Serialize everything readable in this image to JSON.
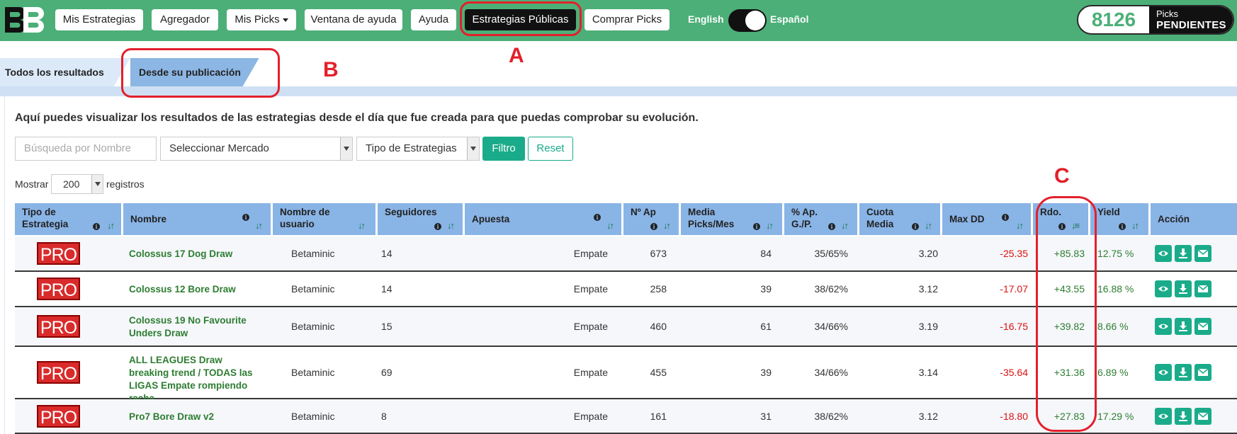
{
  "nav": {
    "logo": "BB",
    "items": [
      {
        "label": "Mis Estrategias"
      },
      {
        "label": "Agregador"
      },
      {
        "label": "Mis Picks"
      },
      {
        "label": "Ventana de ayuda"
      },
      {
        "label": "Ayuda"
      },
      {
        "label": "Estrategias Públicas"
      },
      {
        "label": "Comprar Picks"
      }
    ],
    "lang_left": "English",
    "lang_right": "Español",
    "picks_count": "8126",
    "picks_label_1": "Picks",
    "picks_label_2": "PENDIENTES"
  },
  "annotations": {
    "a": "A",
    "b": "B",
    "c": "C"
  },
  "tabs": [
    {
      "label": "Todos los resultados"
    },
    {
      "label": "Desde su publicación"
    }
  ],
  "intro": "Aquí puedes visualizar los resultados de las estrategias desde el día que fue creada para que puedas comprobar su evolución.",
  "filters": {
    "search_placeholder": "Búsqueda por Nombre",
    "market": "Seleccionar Mercado",
    "type": "Tipo de Estrategias",
    "filter_btn": "Filtro",
    "reset_btn": "Reset"
  },
  "show": {
    "prefix": "Mostrar",
    "value": "200",
    "suffix": "registros"
  },
  "columns": [
    {
      "l1": "Tipo de",
      "l2": "Estrategia"
    },
    {
      "l1": "Nombre",
      "l2": ""
    },
    {
      "l1": "Nombre de",
      "l2": "usuario"
    },
    {
      "l1": "Seguidores",
      "l2": ""
    },
    {
      "l1": "Apuesta",
      "l2": ""
    },
    {
      "l1": "Nº Ap",
      "l2": ""
    },
    {
      "l1": "Media",
      "l2": "Picks/Mes"
    },
    {
      "l1": "% Ap.",
      "l2": "G./P."
    },
    {
      "l1": "Cuota",
      "l2": "Media"
    },
    {
      "l1": "Max DD",
      "l2": ""
    },
    {
      "l1": "Rdo.",
      "l2": ""
    },
    {
      "l1": "Yield",
      "l2": ""
    },
    {
      "l1": "Acción",
      "l2": ""
    }
  ],
  "rows": [
    {
      "type": "PRO",
      "name": "Colossus 17 Dog Draw",
      "user": "Betaminic",
      "followers": "14",
      "bet": "Empate",
      "n_ap": "673",
      "media": "84",
      "pct": "35/65%",
      "cuota": "3.20",
      "maxdd": "-25.35",
      "rdo": "+85.83",
      "yield": "12.75 %"
    },
    {
      "type": "PRO",
      "name": "Colossus 12 Bore Draw",
      "user": "Betaminic",
      "followers": "14",
      "bet": "Empate",
      "n_ap": "258",
      "media": "39",
      "pct": "38/62%",
      "cuota": "3.12",
      "maxdd": "-17.07",
      "rdo": "+43.55",
      "yield": "16.88 %"
    },
    {
      "type": "PRO",
      "name": "Colossus 19 No Favourite Unders Draw",
      "user": "Betaminic",
      "followers": "15",
      "bet": "Empate",
      "n_ap": "460",
      "media": "61",
      "pct": "34/66%",
      "cuota": "3.19",
      "maxdd": "-16.75",
      "rdo": "+39.82",
      "yield": "8.66 %"
    },
    {
      "type": "PRO",
      "name": "ALL LEAGUES Draw breaking trend / TODAS las LIGAS Empate rompiendo racha",
      "user": "Betaminic",
      "followers": "69",
      "bet": "Empate",
      "n_ap": "455",
      "media": "39",
      "pct": "34/66%",
      "cuota": "3.14",
      "maxdd": "-35.64",
      "rdo": "+31.36",
      "yield": "6.89 %"
    },
    {
      "type": "PRO",
      "name": "Pro7 Bore Draw v2",
      "user": "Betaminic",
      "followers": "8",
      "bet": "Empate",
      "n_ap": "161",
      "media": "31",
      "pct": "38/62%",
      "cuota": "3.12",
      "maxdd": "-18.80",
      "rdo": "+27.83",
      "yield": "17.29 %"
    }
  ],
  "colors": {
    "brand_green": "#4caf78",
    "header_blue": "#89b4e6",
    "action_teal": "#1aab8a",
    "annotation_red": "#e3202b"
  }
}
